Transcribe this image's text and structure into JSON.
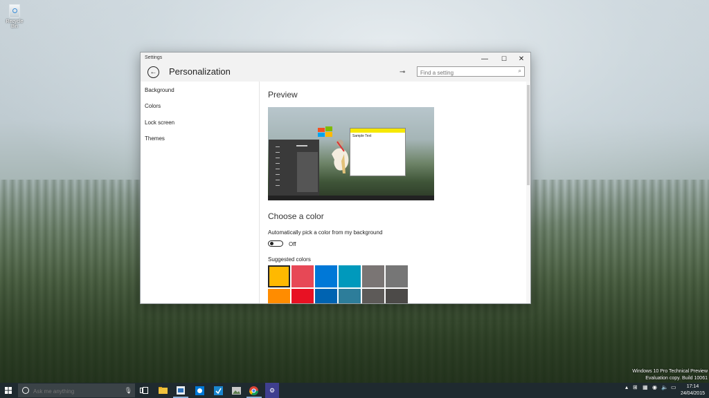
{
  "desktop": {
    "icon_label": "Recycle Bin",
    "watermark_line1": "Windows 10 Pro Technical Preview",
    "watermark_line2": "Evaluation copy. Build 10061"
  },
  "window": {
    "title": "Settings",
    "page_title": "Personalization",
    "search_placeholder": "Find a setting",
    "controls": {
      "minimize": "—",
      "maximize": "☐",
      "close": "✕"
    }
  },
  "sidebar": {
    "items": [
      {
        "label": "Background"
      },
      {
        "label": "Colors"
      },
      {
        "label": "Lock screen"
      },
      {
        "label": "Themes"
      }
    ]
  },
  "content": {
    "preview_heading": "Preview",
    "sample_text": "Sample Text",
    "choose_heading": "Choose a color",
    "auto_label": "Automatically pick a color from my background",
    "toggle_state": "Off",
    "suggested_label": "Suggested colors",
    "swatches_row1": [
      "#FFB900",
      "#E74856",
      "#0078D7",
      "#0099BC",
      "#7A7574",
      "#767676"
    ],
    "swatches_row2": [
      "#FF8C00",
      "#E81123",
      "#0063B1",
      "#2D7D9A",
      "#5D5A58",
      "#4C4A48"
    ],
    "selected_swatch": "#FFB900"
  },
  "taskbar": {
    "search_placeholder": "Ask me anything",
    "time": "17:14",
    "date": "24/04/2015",
    "apps": [
      "task-view-icon",
      "file-explorer-icon",
      "store-icon",
      "skype-icon",
      "calendar-icon",
      "photos-icon",
      "chrome-icon",
      "settings-app-icon"
    ]
  }
}
